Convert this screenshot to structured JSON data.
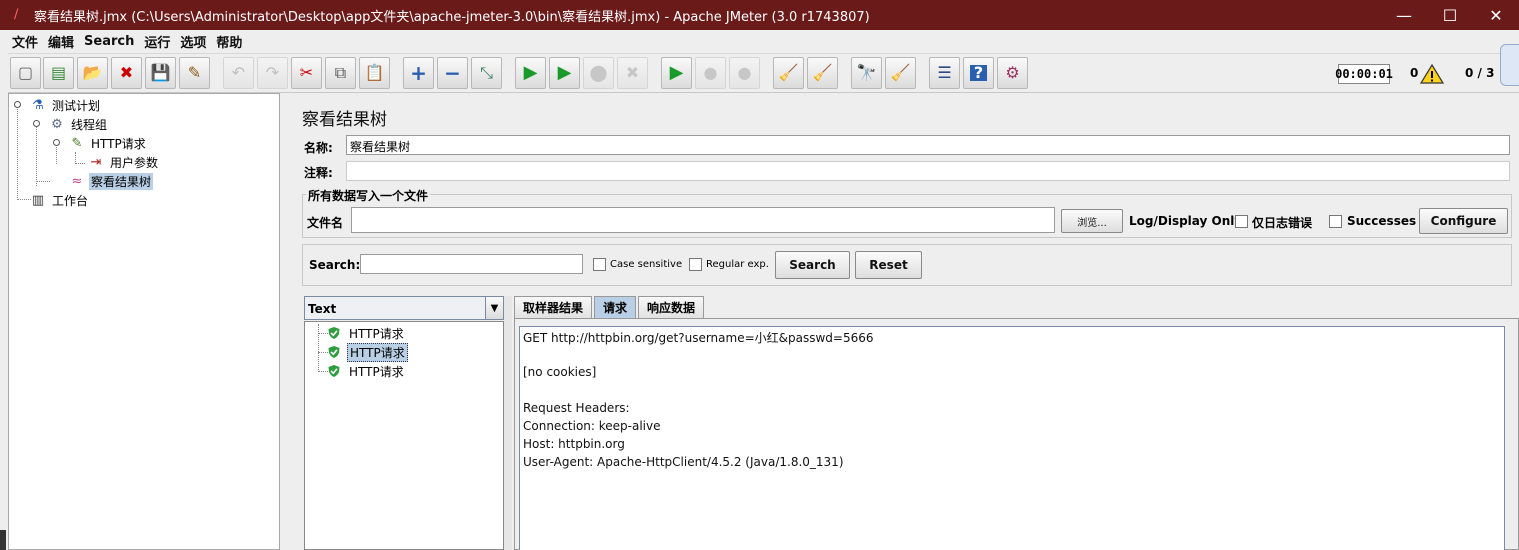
{
  "window": {
    "title": "察看结果树.jmx (C:\\Users\\Administrator\\Desktop\\app文件夹\\apache-jmeter-3.0\\bin\\察看结果树.jmx) - Apache JMeter (3.0 r1743807)",
    "minimize": "—",
    "maximize": "☐",
    "close": "✕"
  },
  "menu": [
    "文件",
    "编辑",
    "Search",
    "运行",
    "选项",
    "帮助"
  ],
  "toolbar": {
    "buttons": [
      {
        "icon": "new-icon",
        "glyph": "▢"
      },
      {
        "icon": "templates-icon",
        "glyph": "▤"
      },
      {
        "icon": "open-icon",
        "glyph": "📂"
      },
      {
        "icon": "close-icon",
        "glyph": "✖"
      },
      {
        "icon": "save-icon",
        "glyph": "💾"
      },
      {
        "icon": "save-as-icon",
        "glyph": "✎"
      },
      {
        "icon": "undo-icon",
        "glyph": "↶"
      },
      {
        "icon": "redo-icon",
        "glyph": "↷"
      },
      {
        "icon": "cut-icon",
        "glyph": "✂"
      },
      {
        "icon": "copy-icon",
        "glyph": "⧉"
      },
      {
        "icon": "paste-icon",
        "glyph": "📋"
      },
      {
        "icon": "expand-icon",
        "glyph": "+"
      },
      {
        "icon": "collapse-icon",
        "glyph": "−"
      },
      {
        "icon": "toggle-icon",
        "glyph": "⤡"
      },
      {
        "icon": "start-icon",
        "glyph": "▶"
      },
      {
        "icon": "start-no-pause-icon",
        "glyph": "▶"
      },
      {
        "icon": "stop-icon",
        "glyph": "⬤"
      },
      {
        "icon": "shutdown-icon",
        "glyph": "✖"
      },
      {
        "icon": "remote-start-icon",
        "glyph": "▶"
      },
      {
        "icon": "remote-stop-icon",
        "glyph": "●"
      },
      {
        "icon": "remote-shutdown-icon",
        "glyph": "●"
      },
      {
        "icon": "clear-icon",
        "glyph": "🧹"
      },
      {
        "icon": "clear-all-icon",
        "glyph": "🧹"
      },
      {
        "icon": "search-icon",
        "glyph": "🔭"
      },
      {
        "icon": "reset-search-icon",
        "glyph": "🧹"
      },
      {
        "icon": "function-helper-icon",
        "glyph": "☰"
      },
      {
        "icon": "help-icon",
        "glyph": "?"
      },
      {
        "icon": "logger-icon",
        "glyph": "⚙"
      }
    ],
    "timer": "00:00:01",
    "error_count": "0",
    "threads": "0 / 3"
  },
  "tree": {
    "items": [
      {
        "label": "测试计划",
        "icon": "test-plan-icon",
        "glyph": "⚗"
      },
      {
        "label": "线程组",
        "icon": "thread-group-icon",
        "glyph": "⚙"
      },
      {
        "label": "HTTP请求",
        "icon": "http-sampler-icon",
        "glyph": "✎"
      },
      {
        "label": "用户参数",
        "icon": "user-parameters-icon",
        "glyph": "⇥"
      },
      {
        "label": "察看结果树",
        "icon": "view-results-tree-icon",
        "glyph": "≈"
      },
      {
        "label": "工作台",
        "icon": "workbench-icon",
        "glyph": "▥"
      }
    ]
  },
  "panel": {
    "title": "察看结果树",
    "name_label": "名称:",
    "name_value": "察看结果树",
    "comment_label": "注释:",
    "comment_value": "",
    "file_group_title": "所有数据写入一个文件",
    "filename_label": "文件名",
    "filename_value": "",
    "browse_label": "浏览...",
    "log_display_label": "Log/Display Only:",
    "errors_only_label": "仅日志错误",
    "successes_label": "Successes",
    "configure_label": "Configure"
  },
  "search": {
    "label": "Search:",
    "value": "",
    "case_sensitive_label": "Case sensitive",
    "regex_label": "Regular exp.",
    "search_button": "Search",
    "reset_button": "Reset"
  },
  "results": {
    "renderer": "Text",
    "items": [
      "HTTP请求",
      "HTTP请求",
      "HTTP请求"
    ],
    "selected_index": 1
  },
  "tabs": [
    "取样器结果",
    "请求",
    "响应数据"
  ],
  "active_tab": "请求",
  "request_text": [
    "GET http://httpbin.org/get?username=小红&passwd=5666",
    "",
    "[no cookies]",
    "",
    "Request Headers:",
    "Connection: keep-alive",
    "Host: httpbin.org",
    "User-Agent: Apache-HttpClient/4.5.2 (Java/1.8.0_131)"
  ],
  "colors": {
    "titlebar": "#6b1a1a",
    "selection": "#b8cfe5",
    "ok_green": "#2e9e3e"
  }
}
